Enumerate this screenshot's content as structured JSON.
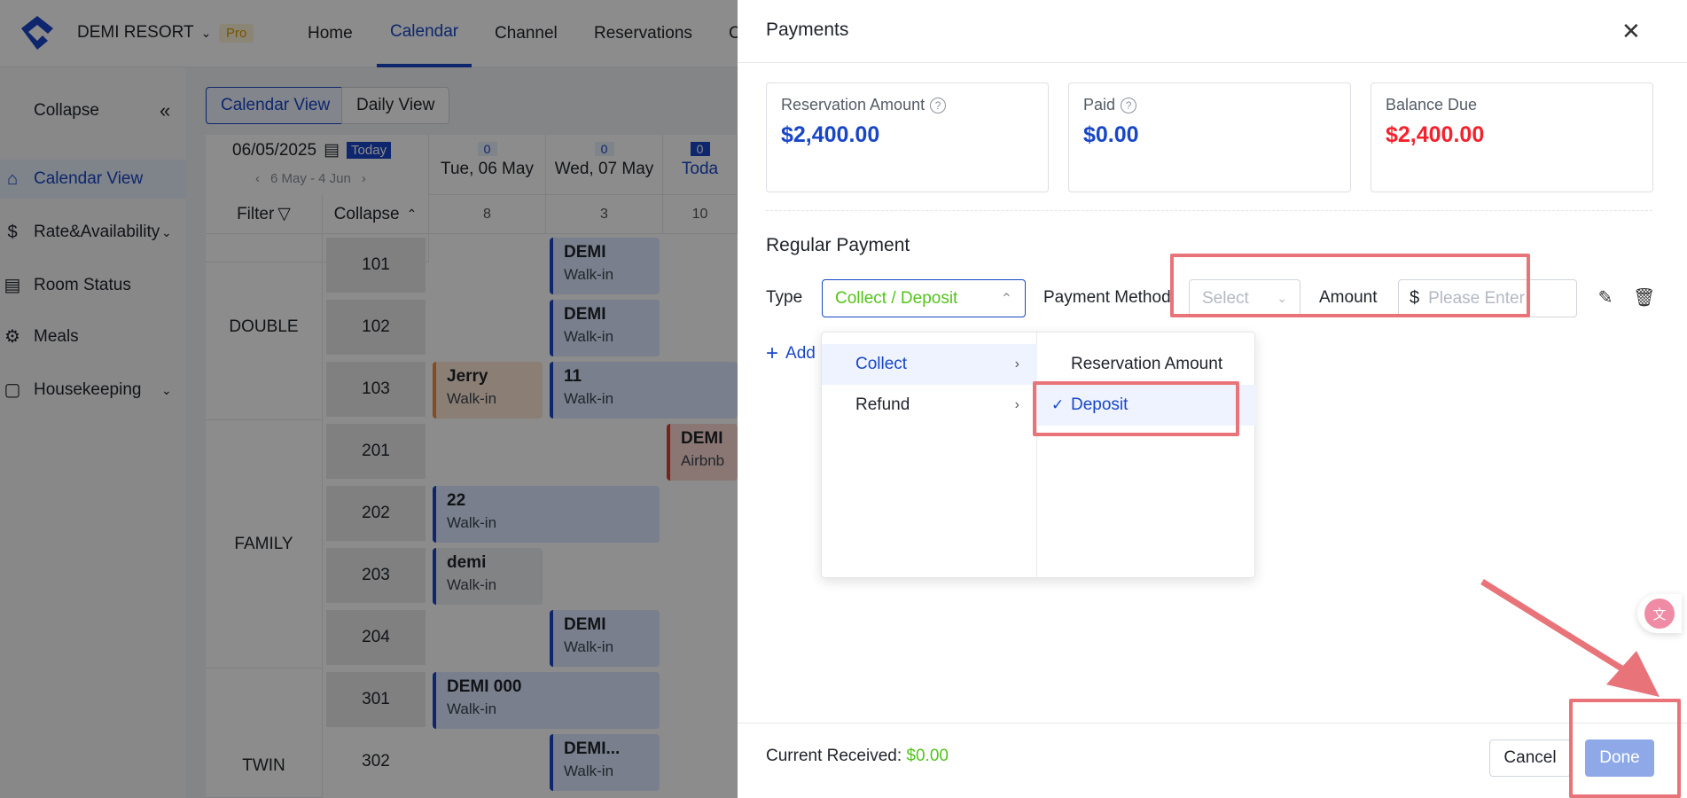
{
  "app": {
    "brand": "DEMI RESORT",
    "plan_badge": "Pro",
    "nav": [
      "Home",
      "Calendar",
      "Channel",
      "Reservations",
      "C"
    ],
    "active_nav": "Calendar"
  },
  "sidebar": {
    "collapse_label": "Collapse",
    "items": [
      {
        "label": "Calendar View",
        "icon": "home-icon"
      },
      {
        "label": "Rate&Availability",
        "icon": "dollar-icon"
      },
      {
        "label": "Room Status",
        "icon": "calendar-icon"
      },
      {
        "label": "Meals",
        "icon": "utensils-icon"
      },
      {
        "label": "Housekeeping",
        "icon": "broom-icon"
      }
    ]
  },
  "calendar": {
    "view_tabs": [
      "Calendar View",
      "Daily View"
    ],
    "date": "06/05/2025",
    "today_badge": "Today",
    "range": "6 May - 4 Jun",
    "filter_label": "Filter",
    "collapse_label": "Collapse",
    "columns": [
      {
        "count": "0",
        "day": "Tue, 06 May",
        "avail": "8"
      },
      {
        "count": "0",
        "day": "Wed, 07 May",
        "avail": "3"
      },
      {
        "count": "0",
        "day": "Toda",
        "avail": "10"
      }
    ],
    "groups": [
      "DOUBLE",
      "FAMILY",
      "TWIN"
    ],
    "rooms": [
      "101",
      "102",
      "103",
      "201",
      "202",
      "203",
      "204",
      "301",
      "302"
    ],
    "bookings": [
      {
        "name": "DEMI",
        "source": "Walk-in"
      },
      {
        "name": "DEMI",
        "source": "Walk-in"
      },
      {
        "name": "Jerry",
        "source": "Walk-in"
      },
      {
        "name": "11",
        "source": "Walk-in"
      },
      {
        "name": "DEMI",
        "source": "Airbnb"
      },
      {
        "name": "22",
        "source": "Walk-in"
      },
      {
        "name": "demi",
        "source": "Walk-in"
      },
      {
        "name": "DEMI",
        "source": "Walk-in"
      },
      {
        "name": "DEMI 000",
        "source": "Walk-in"
      },
      {
        "name": "DEMI...",
        "source": "Walk-in"
      }
    ]
  },
  "payments": {
    "title": "Payments",
    "cards": [
      {
        "label": "Reservation Amount",
        "value": "$2,400.00",
        "color": "#1846c7"
      },
      {
        "label": "Paid",
        "value": "$0.00",
        "color": "#1846c7"
      },
      {
        "label": "Balance Due",
        "value": "$2,400.00",
        "color": "#f5222d"
      }
    ],
    "section_title": "Regular Payment",
    "type_label": "Type",
    "type_value": "Collect / Deposit",
    "method_label": "Payment Method",
    "method_placeholder": "Select",
    "amount_label": "Amount",
    "amount_currency": "$",
    "amount_placeholder": "Please Enter",
    "add_label": "Add",
    "dropdown": {
      "level1": [
        "Collect",
        "Refund"
      ],
      "level2": [
        "Reservation Amount",
        "Deposit"
      ],
      "selected_level1": "Collect",
      "selected_level2": "Deposit"
    },
    "footer": {
      "received_label": "Current Received:",
      "received_value": "$0.00",
      "cancel": "Cancel",
      "done": "Done"
    }
  }
}
